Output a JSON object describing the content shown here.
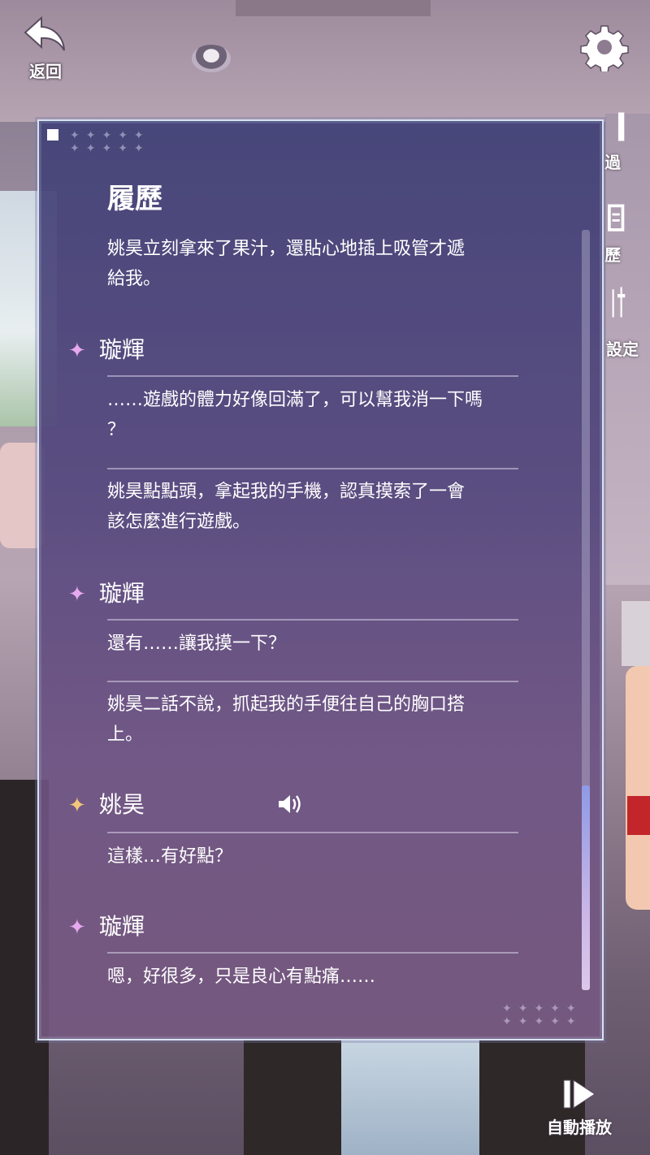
{
  "nav": {
    "back_label": "返回"
  },
  "side": {
    "skip_label": "過",
    "log_label": "歷",
    "settings_label": "設定",
    "auto_label": "自動播放"
  },
  "panel": {
    "title": "履歷",
    "entries": [
      {
        "text_line1": "姚昊立刻拿來了果汁，還貼心地插上吸管才遞",
        "text_line2": "給我。"
      },
      {
        "speaker": "璇輝"
      },
      {
        "text_line1": "……遊戲的體力好像回滿了，可以幫我消一下嗎",
        "text_line2": "？"
      },
      {
        "text_line1": "姚昊點點頭，拿起我的手機，認真摸索了一會",
        "text_line2": "該怎麼進行遊戲。"
      },
      {
        "speaker": "璇輝"
      },
      {
        "text_line1": "還有……讓我摸一下？"
      },
      {
        "text_line1": "姚昊二話不說，抓起我的手便往自己的胸口搭",
        "text_line2": "上。"
      },
      {
        "speaker": "姚昊"
      },
      {
        "text_line1": "這樣…有好點？"
      },
      {
        "speaker": "璇輝"
      },
      {
        "text_line1": "嗯，好很多，只是良心有點痛……"
      }
    ]
  },
  "colors": {
    "speaker_star": "#e6a8ee",
    "speaker_star_voiced": "#f3c77a"
  },
  "icons": [
    "back-arrow-icon",
    "gear-icon",
    "skip-icon",
    "log-icon",
    "auto-play-icon",
    "speaker-voice-icon",
    "sparkle-icon"
  ]
}
